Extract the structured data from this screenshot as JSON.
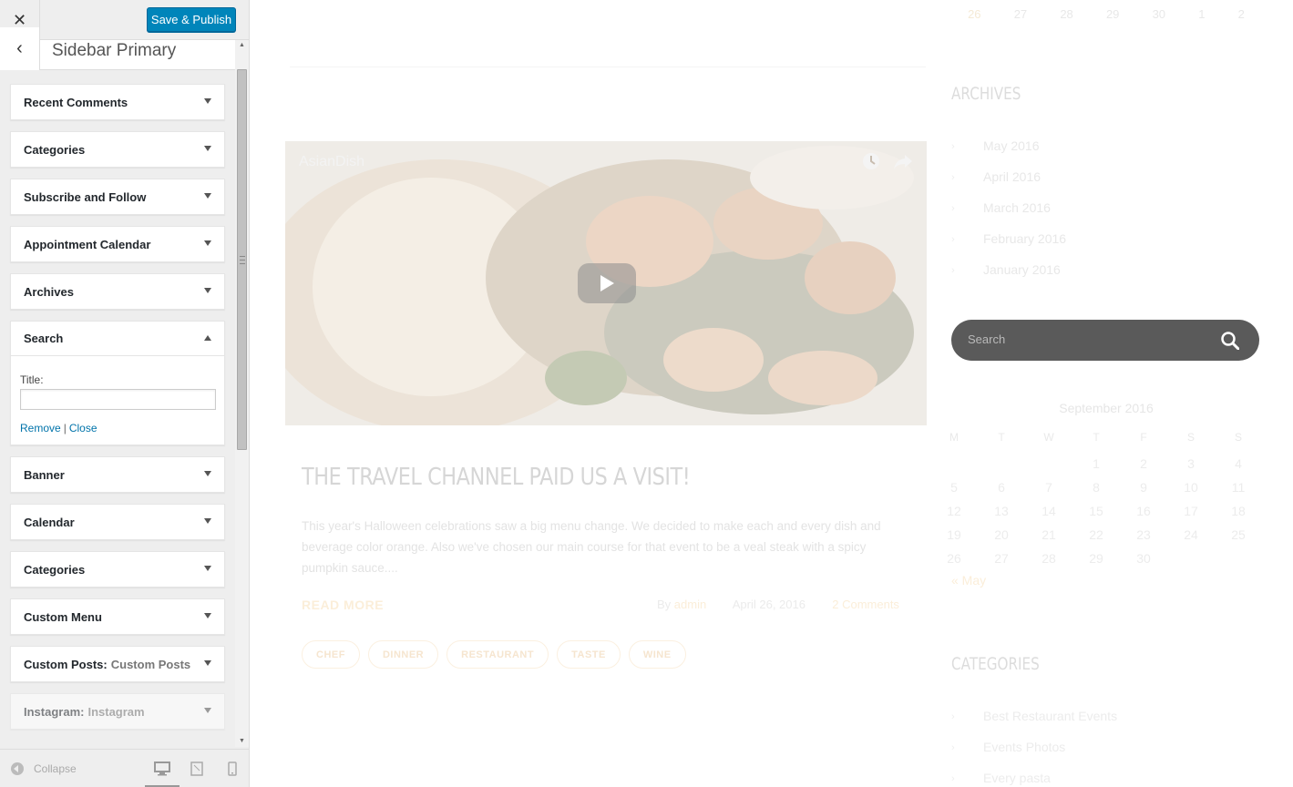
{
  "customizer": {
    "save_label": "Save & Publish",
    "close_glyph": "✕",
    "back_glyph": "‹",
    "section_title": "Sidebar Primary",
    "widgets_top": [
      {
        "label": "Recent Comments"
      },
      {
        "label": "Categories"
      },
      {
        "label": "Subscribe and Follow"
      },
      {
        "label": "Appointment Calendar"
      },
      {
        "label": "Archives"
      }
    ],
    "search_widget": {
      "label": "Search",
      "title_label": "Title:",
      "title_value": "",
      "remove_label": "Remove",
      "separator": "|",
      "close_label": "Close"
    },
    "widgets_bottom": [
      {
        "label": "Banner",
        "sub": ""
      },
      {
        "label": "Calendar",
        "sub": ""
      },
      {
        "label": "Categories",
        "sub": ""
      },
      {
        "label": "Custom Menu",
        "sub": ""
      },
      {
        "label": "Custom Posts:",
        "sub": "Custom Posts"
      },
      {
        "label": "Instagram:",
        "sub": "Instagram"
      }
    ],
    "collapse_label": "Collapse"
  },
  "preview": {
    "top_calendar_row": [
      "26",
      "27",
      "28",
      "29",
      "30",
      "1",
      "2"
    ],
    "video": {
      "title": "AsianDish"
    },
    "post": {
      "title": "The Travel Channel Paid Us A Visit!",
      "excerpt": "This year's Halloween celebrations saw a big menu change. We decided to make each and every dish and beverage color orange. Also we've chosen our main course for that event to be a veal steak with a spicy pumpkin sauce....",
      "read_more": "READ MORE",
      "by": "By",
      "author": "admin",
      "date": "April 26, 2016",
      "comments": "2 Comments",
      "tags": [
        "CHEF",
        "DINNER",
        "RESTAURANT",
        "TASTE",
        "WINE"
      ]
    },
    "archives": {
      "title": "Archives",
      "items": [
        "May 2016",
        "April 2016",
        "March 2016",
        "February 2016",
        "January 2016"
      ]
    },
    "search": {
      "placeholder": "Search"
    },
    "calendar": {
      "caption": "September 2016",
      "days": [
        "M",
        "T",
        "W",
        "T",
        "F",
        "S",
        "S"
      ],
      "cells": [
        "",
        "",
        "",
        "1",
        "2",
        "3",
        "4",
        "5",
        "6",
        "7",
        "8",
        "9",
        "10",
        "11",
        "12",
        "13",
        "14",
        "15",
        "16",
        "17",
        "18",
        "19",
        "20",
        "21",
        "22",
        "23",
        "24",
        "25",
        "26",
        "27",
        "28",
        "29",
        "30",
        "",
        ""
      ],
      "prev_link": "« May"
    },
    "categories": {
      "title": "Categories",
      "items": [
        "Best Restaurant Events",
        "Events Photos",
        "Every pasta"
      ]
    }
  },
  "colors": {
    "primary_button": "#0085ba",
    "link": "#0073aa",
    "accent": "#f6d7a7",
    "search_pill": "#5a5a5a"
  }
}
